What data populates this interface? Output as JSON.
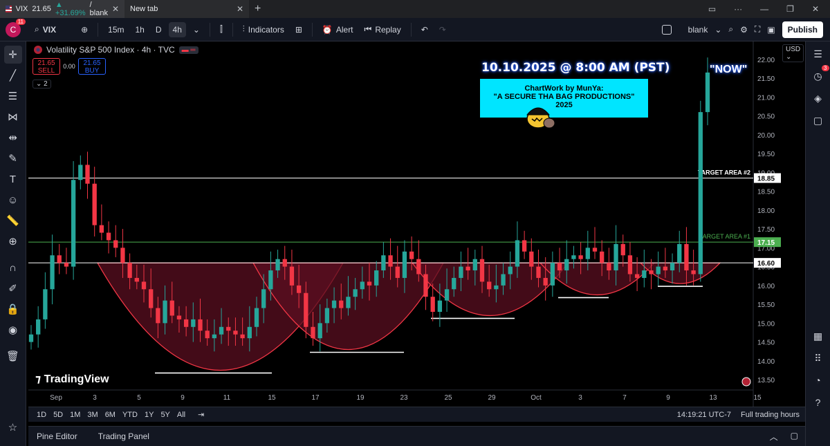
{
  "browser": {
    "tab1_title": "VIX",
    "tab1_price": "21.65",
    "tab1_change": "▲ +31.69%",
    "tab1_suffix": "/ blank",
    "tab2_title": "New tab",
    "new_tab_label": "+"
  },
  "toolbar": {
    "avatar_letter": "C",
    "avatar_badge": "11",
    "symbol": "VIX",
    "intervals": [
      "15m",
      "1h",
      "D",
      "4h"
    ],
    "active_interval": "4h",
    "indicators_label": "Indicators",
    "alert_label": "Alert",
    "replay_label": "Replay",
    "layout_name": "blank",
    "publish_label": "Publish"
  },
  "legend": {
    "title": "Volatility S&P 500 Index · 4h · TVC",
    "sell_price": "21.65",
    "sell_label": "SELL",
    "spread": "0.00",
    "buy_price": "21.65",
    "buy_label": "BUY",
    "collapsed_count": "2"
  },
  "annotations": {
    "date_title": "10.10.2025 @ 8:00 AM (PST)",
    "now_label": "\"NOW\"",
    "note_line1": "ChartWork by MunYa:",
    "note_line2": "\"A SECURE THA BAG PRODUCTIONS\"",
    "note_line3": "2025",
    "target2": "TARGET AREA #2",
    "target1": "TARGET AREA #1"
  },
  "brand": {
    "tradingview": "TradingView"
  },
  "currency": "USD",
  "colors": {
    "up": "#26a69a",
    "down": "#f23645",
    "background": "#000000",
    "arc": "#f23645",
    "arc_fill": "#5a0f20",
    "target1": "#4caf50"
  },
  "chart_data": {
    "type": "candlestick",
    "title": "Volatility S&P 500 Index · 4h · TVC",
    "ylim": [
      13.3,
      22.4
    ],
    "y_ticks": [
      "22.00",
      "21.50",
      "21.00",
      "20.50",
      "20.00",
      "19.50",
      "19.00",
      "18.50",
      "18.00",
      "17.50",
      "17.00",
      "16.50",
      "16.00",
      "15.50",
      "15.00",
      "14.50",
      "14.00",
      "13.50"
    ],
    "x_ticks": [
      "Sep",
      "3",
      "5",
      "9",
      "11",
      "15",
      "17",
      "19",
      "23",
      "25",
      "29",
      "Oct",
      "3",
      "7",
      "9",
      "13",
      "15"
    ],
    "horizontal_levels": [
      {
        "label": "18.85",
        "value": 18.85,
        "color": "#ffffff"
      },
      {
        "label": "17.15",
        "value": 17.15,
        "color": "#4caf50"
      },
      {
        "label": "16.60",
        "value": 16.6,
        "color": "#ffffff"
      }
    ],
    "close_prices": [
      14.7,
      15.1,
      15.9,
      16.8,
      16.6,
      16.5,
      18.8,
      19.2,
      18.7,
      17.6,
      17.4,
      17.2,
      17.0,
      16.6,
      16.2,
      16.1,
      15.9,
      15.4,
      15.0,
      15.6,
      15.2,
      15.1,
      14.9,
      15.1,
      14.8,
      14.6,
      14.7,
      14.9,
      14.8,
      14.7,
      14.6,
      14.9,
      15.4,
      15.9,
      16.4,
      16.7,
      16.5,
      16.0,
      15.8,
      14.9,
      14.6,
      15.0,
      15.4,
      15.6,
      15.4,
      15.7,
      15.9,
      16.1,
      16.0,
      16.4,
      16.8,
      16.5,
      16.2,
      16.9,
      16.7,
      16.3,
      15.7,
      15.3,
      15.6,
      15.9,
      16.2,
      16.5,
      16.4,
      16.7,
      16.1,
      15.9,
      16.0,
      16.3,
      16.5,
      17.2,
      16.9,
      16.5,
      16.2,
      16.0,
      16.6,
      16.4,
      16.7,
      16.8,
      16.7,
      17.0,
      16.9,
      16.6,
      16.4,
      17.1,
      16.8,
      16.3,
      16.2,
      16.4,
      16.3,
      16.5,
      16.4,
      16.6,
      17.1,
      16.4,
      16.3,
      20.6,
      21.65
    ],
    "arcs": [
      {
        "from_idx": 14,
        "to_idx": 48,
        "bottom": 13.75
      },
      {
        "from_idx": 46,
        "to_idx": 74,
        "bottom": 14.3
      },
      {
        "from_idx": 72,
        "to_idx": 96,
        "bottom": 15.2
      },
      {
        "from_idx": 94,
        "to_idx": 118,
        "bottom": 15.75
      },
      {
        "from_idx": 116,
        "to_idx": 130,
        "bottom": 16.05
      }
    ]
  },
  "bottom": {
    "ranges": [
      "1D",
      "5D",
      "1M",
      "3M",
      "6M",
      "YTD",
      "1Y",
      "5Y",
      "All"
    ],
    "clock": "14:19:21 UTC-7",
    "session": "Full trading hours"
  },
  "footer": {
    "pine": "Pine Editor",
    "panel": "Trading Panel"
  }
}
